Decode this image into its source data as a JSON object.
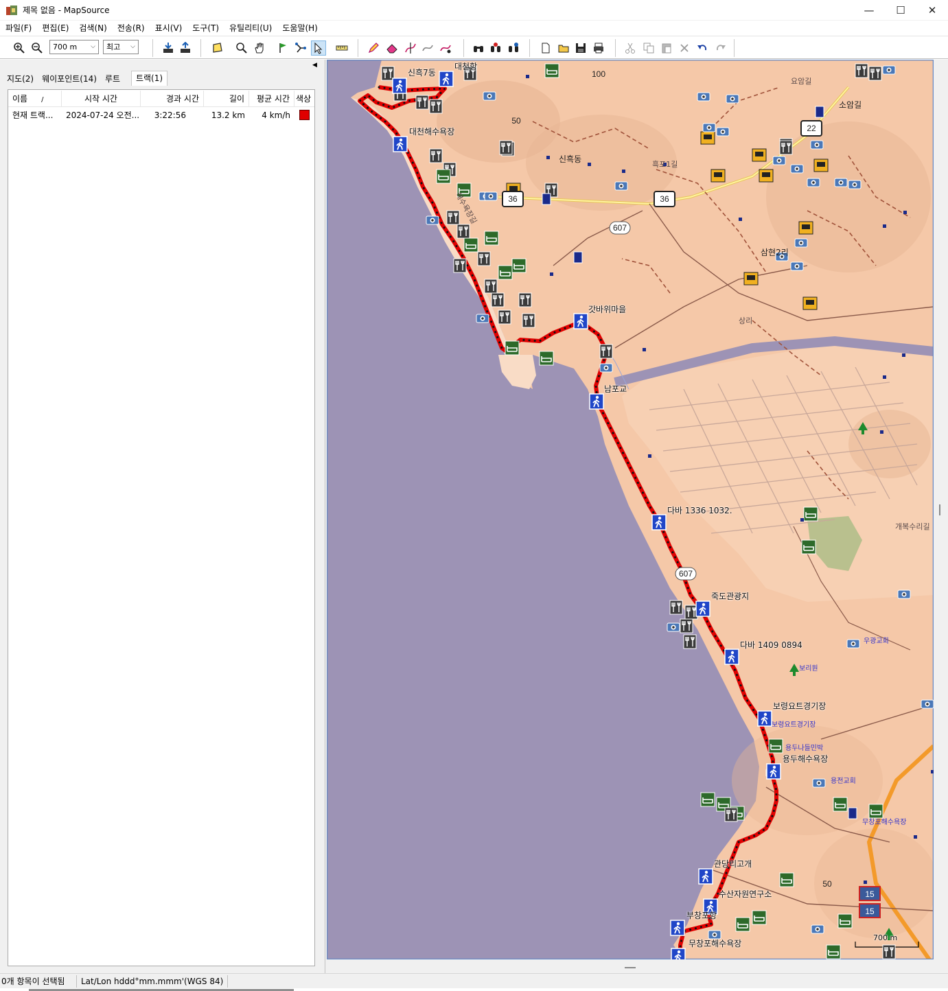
{
  "window": {
    "title": "제목 없음 - MapSource"
  },
  "menu": [
    "파일(F)",
    "편집(E)",
    "검색(N)",
    "전송(R)",
    "표시(V)",
    "도구(T)",
    "유틸리티(U)",
    "도움말(H)"
  ],
  "toolbar": {
    "zoom_value": "700 m",
    "detail_value": "최고"
  },
  "tabs": [
    "지도(2)",
    "웨이포인트(14)",
    "루트",
    "트랙(1)"
  ],
  "active_tab": 3,
  "track_table": {
    "columns": [
      "이름",
      "시작 시간",
      "경과 시간",
      "길이",
      "평균 시간",
      "색상"
    ],
    "sort_indicator": "/",
    "rows": [
      {
        "name": "현재 트랙...",
        "start": "2024-07-24 오전...",
        "elapsed": "3:22:56",
        "length": "13.2 km",
        "avg": "4 km/h",
        "color": "#e00000"
      }
    ]
  },
  "map": {
    "waypoints": [
      "신흑7동",
      "대천항",
      "대천해수욕장",
      "갓바위마을",
      "남포교",
      "다바 1336 1032.",
      "죽도관광지",
      "다바 1409 0894",
      "보령요트경기장",
      "용두해수욕장",
      "관당리고개",
      "수산자원연구소",
      "부창포항",
      "무창포해수욕장"
    ],
    "place_labels": [
      "신흑동",
      "삼현2리",
      "소암길",
      "요암길",
      "흑포1길",
      "상리",
      "개복수리길",
      "해수욕장길"
    ],
    "poi_labels": [
      "보령요트경기장",
      "우광교회",
      "보리원",
      "용전교회",
      "용두나들민박",
      "무창포해수욕장"
    ],
    "road_shields": [
      "36",
      "36",
      "607",
      "607",
      "15",
      "15",
      "100",
      "50",
      "50",
      "22"
    ],
    "scale_label": "700 m",
    "track_color": "#e00000"
  },
  "status": {
    "selection": "0개 항목이 선택됨",
    "coord_format": "Lat/Lon hddd°mm.mmm'(WGS 84)"
  }
}
